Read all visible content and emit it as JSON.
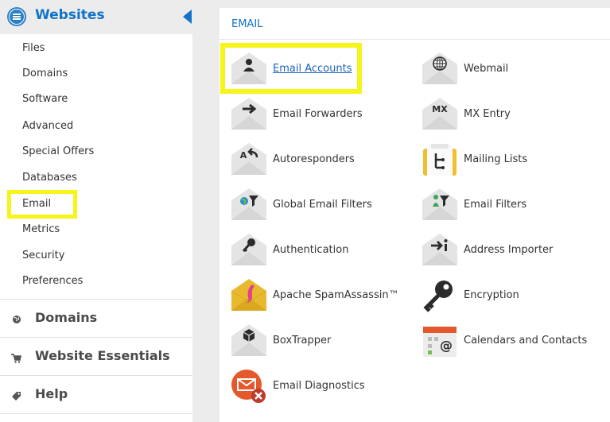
{
  "sidebar": {
    "header": {
      "title": "Websites",
      "icon": "websites-icon"
    },
    "items": [
      "Files",
      "Domains",
      "Software",
      "Advanced",
      "Special Offers",
      "Databases",
      "Email",
      "Metrics",
      "Security",
      "Preferences"
    ],
    "sections": [
      {
        "label": "Domains",
        "icon": "globe-icon"
      },
      {
        "label": "Website Essentials",
        "icon": "cart-icon"
      },
      {
        "label": "Help",
        "icon": "tag-icon"
      }
    ]
  },
  "panel": {
    "title": "EMAIL",
    "tools": [
      {
        "label": "Email Accounts",
        "icon": "email-accounts-icon"
      },
      {
        "label": "Webmail",
        "icon": "webmail-icon"
      },
      {
        "label": "Email Forwarders",
        "icon": "email-forwarders-icon"
      },
      {
        "label": "MX Entry",
        "icon": "mx-entry-icon"
      },
      {
        "label": "Autoresponders",
        "icon": "autoresponders-icon"
      },
      {
        "label": "Mailing Lists",
        "icon": "mailing-lists-icon"
      },
      {
        "label": "Global Email Filters",
        "icon": "global-email-filters-icon"
      },
      {
        "label": "Email Filters",
        "icon": "email-filters-icon"
      },
      {
        "label": "Authentication",
        "icon": "authentication-icon"
      },
      {
        "label": "Address Importer",
        "icon": "address-importer-icon"
      },
      {
        "label": "Apache SpamAssassin™",
        "icon": "spamassassin-icon"
      },
      {
        "label": "Encryption",
        "icon": "encryption-icon"
      },
      {
        "label": "BoxTrapper",
        "icon": "boxtrapper-icon"
      },
      {
        "label": "Calendars and Contacts",
        "icon": "calendars-contacts-icon"
      },
      {
        "label": "Email Diagnostics",
        "icon": "email-diagnostics-icon"
      }
    ],
    "icon_glyphs": {
      "mx": "MX",
      "autoresponder": "A"
    }
  },
  "colors": {
    "accent": "#1273c9",
    "highlight": "#f6f41a",
    "envelope": "#e4e4e4",
    "spam_envelope": "#e8b92e",
    "diagnostics": "#e3592c"
  }
}
